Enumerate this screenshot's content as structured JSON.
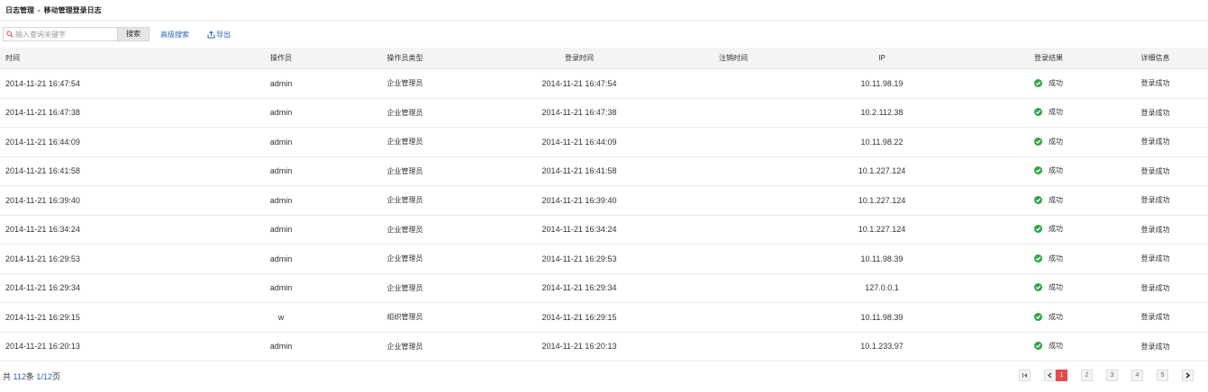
{
  "breadcrumb": {
    "section": "日志管理",
    "separator": "-",
    "page": "移动管理登录日志"
  },
  "toolbar": {
    "search_placeholder": "输入查询关键字",
    "search_value": "",
    "search_button": "搜索",
    "advanced_search": "高级搜索",
    "export": "导出"
  },
  "table": {
    "headers": {
      "time": "时间",
      "operator": "操作员",
      "operator_type": "操作员类型",
      "login_time": "登录时间",
      "logout_time": "注销时间",
      "ip": "IP",
      "result": "登录结果",
      "detail": "详细信息"
    },
    "rows": [
      {
        "time": "2014-11-21 16:47:54",
        "operator": "admin",
        "operator_type": "企业管理员",
        "login_time": "2014-11-21 16:47:54",
        "logout_time": "",
        "ip": "10.11.98.19",
        "result": "成功",
        "detail": "登录成功"
      },
      {
        "time": "2014-11-21 16:47:38",
        "operator": "admin",
        "operator_type": "企业管理员",
        "login_time": "2014-11-21 16:47:38",
        "logout_time": "",
        "ip": "10.2.112.38",
        "result": "成功",
        "detail": "登录成功"
      },
      {
        "time": "2014-11-21 16:44:09",
        "operator": "admin",
        "operator_type": "企业管理员",
        "login_time": "2014-11-21 16:44:09",
        "logout_time": "",
        "ip": "10.11.98.22",
        "result": "成功",
        "detail": "登录成功"
      },
      {
        "time": "2014-11-21 16:41:58",
        "operator": "admin",
        "operator_type": "企业管理员",
        "login_time": "2014-11-21 16:41:58",
        "logout_time": "",
        "ip": "10.1.227.124",
        "result": "成功",
        "detail": "登录成功"
      },
      {
        "time": "2014-11-21 16:39:40",
        "operator": "admin",
        "operator_type": "企业管理员",
        "login_time": "2014-11-21 16:39:40",
        "logout_time": "",
        "ip": "10.1.227.124",
        "result": "成功",
        "detail": "登录成功"
      },
      {
        "time": "2014-11-21 16:34:24",
        "operator": "admin",
        "operator_type": "企业管理员",
        "login_time": "2014-11-21 16:34:24",
        "logout_time": "",
        "ip": "10.1.227.124",
        "result": "成功",
        "detail": "登录成功"
      },
      {
        "time": "2014-11-21 16:29:53",
        "operator": "admin",
        "operator_type": "企业管理员",
        "login_time": "2014-11-21 16:29:53",
        "logout_time": "",
        "ip": "10.11.98.39",
        "result": "成功",
        "detail": "登录成功"
      },
      {
        "time": "2014-11-21 16:29:34",
        "operator": "admin",
        "operator_type": "企业管理员",
        "login_time": "2014-11-21 16:29:34",
        "logout_time": "",
        "ip": "127.0.0.1",
        "result": "成功",
        "detail": "登录成功"
      },
      {
        "time": "2014-11-21 16:29:15",
        "operator": "w",
        "operator_type": "组织管理员",
        "login_time": "2014-11-21 16:29:15",
        "logout_time": "",
        "ip": "10.11.98.39",
        "result": "成功",
        "detail": "登录成功"
      },
      {
        "time": "2014-11-21 16:20:13",
        "operator": "admin",
        "operator_type": "企业管理员",
        "login_time": "2014-11-21 16:20:13",
        "logout_time": "",
        "ip": "10.1.233.97",
        "result": "成功",
        "detail": "登录成功"
      }
    ]
  },
  "footer": {
    "total_prefix": "共",
    "total": "112",
    "total_unit": "条",
    "current_page": "1",
    "page_sep": "/",
    "total_pages": "12",
    "pages_unit": "页"
  },
  "pagination": {
    "pages": [
      "1",
      "2",
      "3",
      "4",
      "5"
    ],
    "active": "1",
    "first_icon": "first-page-icon",
    "prev_icon": "previous-page-icon",
    "next_icon": "next-page-icon"
  },
  "colors": {
    "link": "#2b68b8",
    "success": "#2fa64a",
    "active_page": "#e84a4a",
    "header_bg": "#f4f4f4"
  }
}
